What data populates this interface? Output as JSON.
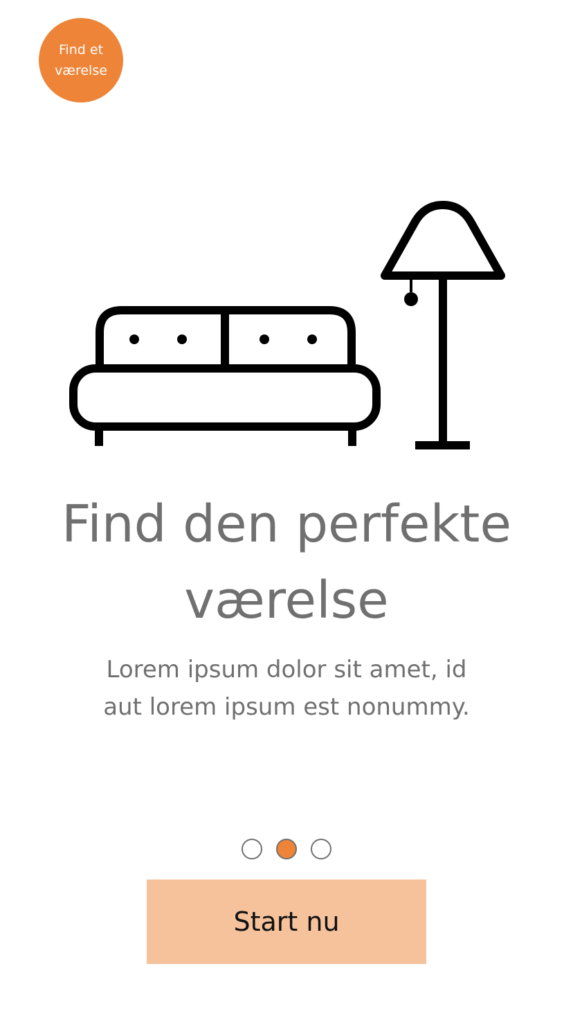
{
  "brand": {
    "logo_line1": "Find et",
    "logo_line2": "værelse",
    "accent_color": "#EE8437"
  },
  "illustration": {
    "icons": [
      "sofa-icon",
      "floor-lamp-icon"
    ]
  },
  "onboarding": {
    "headline_line1": "Find den perfekte",
    "headline_line2": "værelse",
    "body_line1": "Lorem ipsum dolor sit amet, id",
    "body_line2": "aut lorem ipsum est nonummy.",
    "page_count": 3,
    "active_page": 2
  },
  "cta": {
    "label": "Start nu",
    "color": "#F5C29C"
  }
}
